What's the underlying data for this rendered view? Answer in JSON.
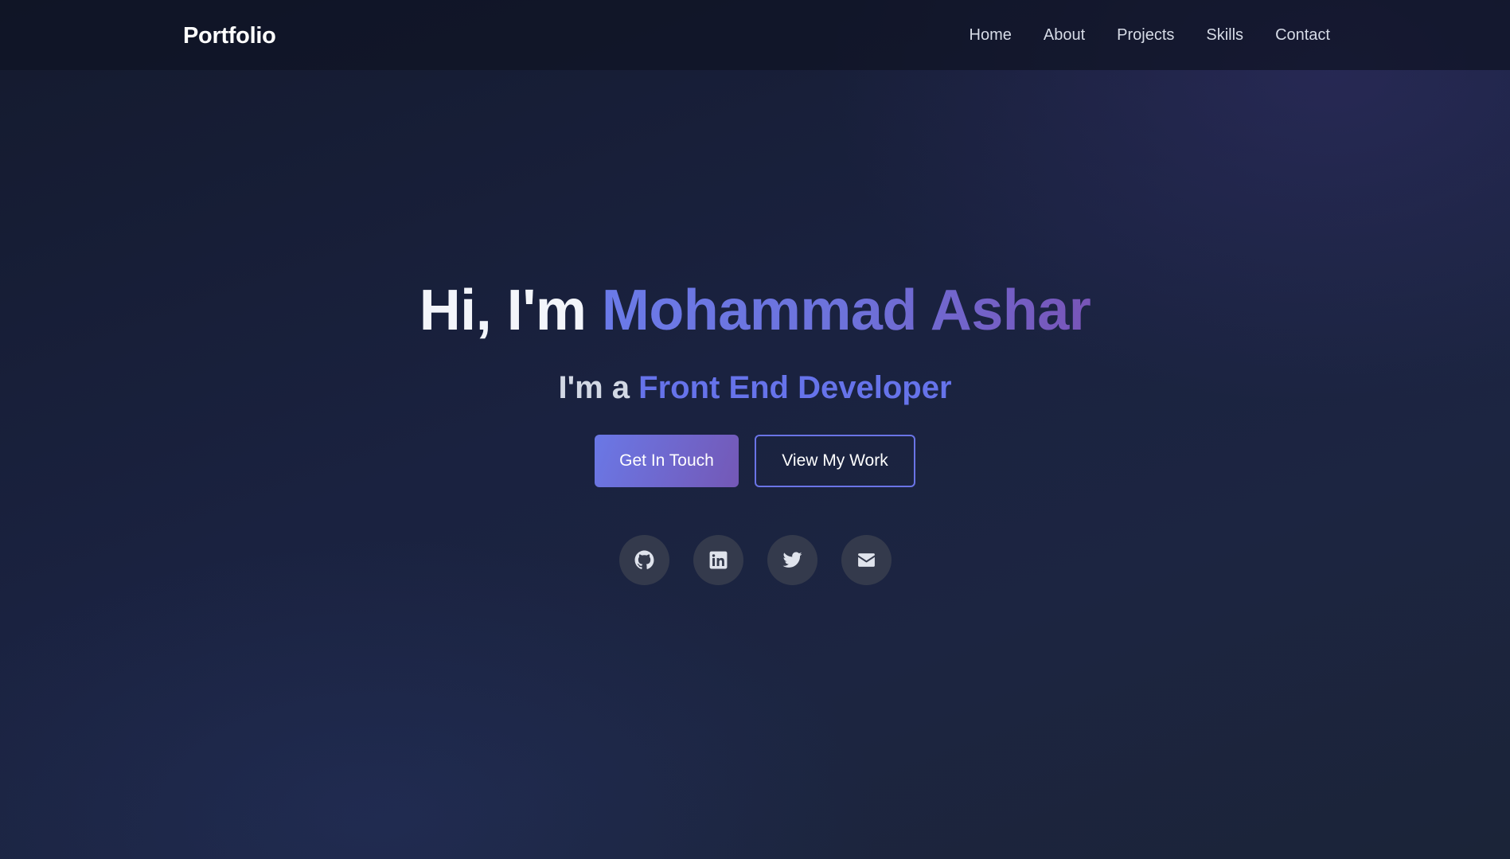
{
  "nav": {
    "logo": "Portfolio",
    "links": [
      "Home",
      "About",
      "Projects",
      "Skills",
      "Contact"
    ]
  },
  "hero": {
    "title_prefix": "Hi, I'm ",
    "name": "Mohammad Ashar",
    "subtitle_prefix": "I'm a ",
    "role": "Front End Developer",
    "primary_button": "Get In Touch",
    "secondary_button": "View My Work"
  },
  "social": {
    "icons": [
      "github-icon",
      "linkedin-icon",
      "twitter-icon",
      "envelope-icon"
    ]
  },
  "colors": {
    "accent": "#6673ea",
    "accent_purple": "#7855b8",
    "background": "#1a2240",
    "navbar": "#11172a",
    "social_bg": "#343a4c"
  }
}
